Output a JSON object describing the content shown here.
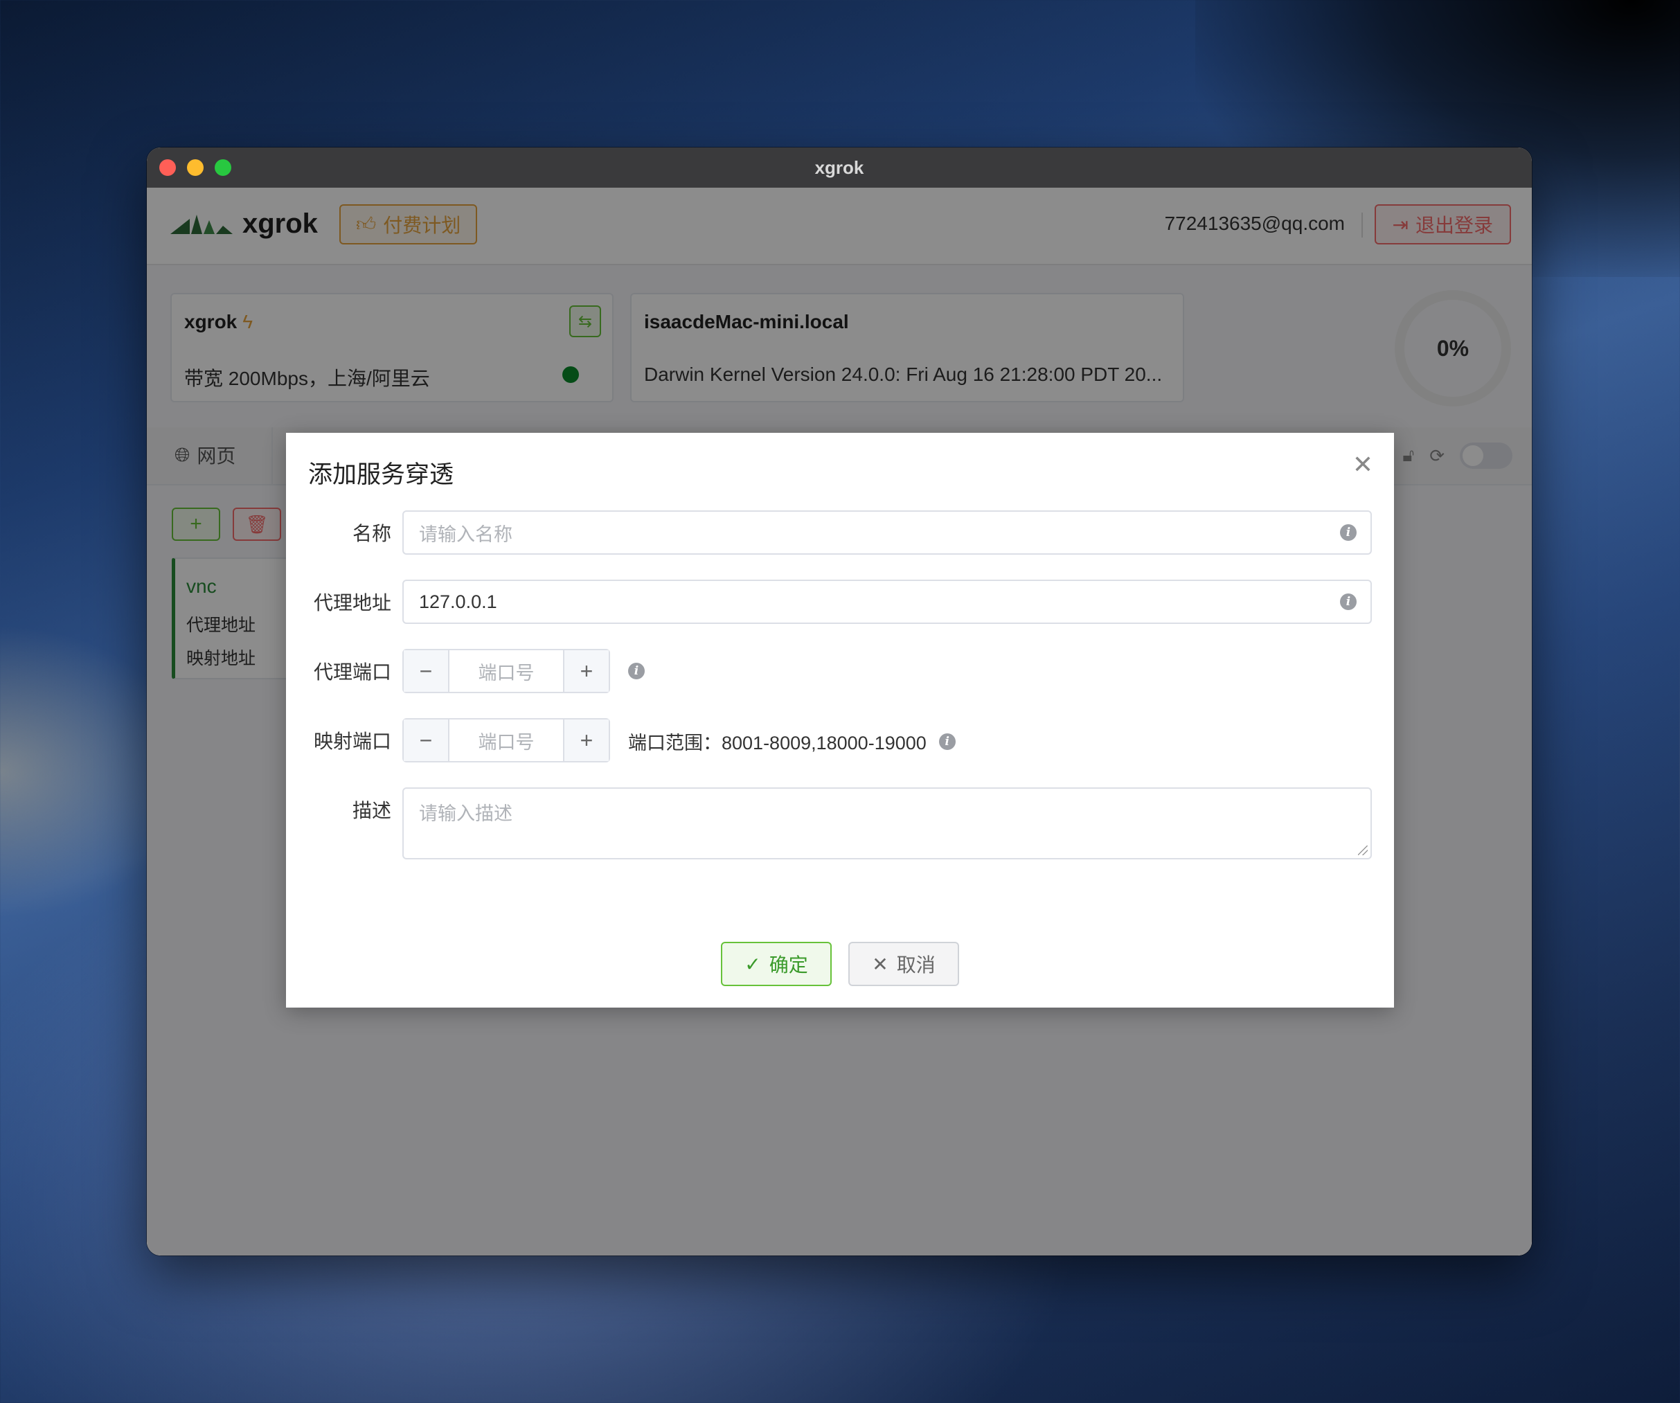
{
  "window": {
    "title": "xgrok"
  },
  "header": {
    "logo_text": "xgrok",
    "plan_label": "付费计划",
    "email": "772413635@qq.com",
    "logout_label": "退出登录"
  },
  "node_card": {
    "title": "xgrok",
    "subtitle": "带宽 200Mbps，上海/阿里云",
    "status_color": "#0a8a2a"
  },
  "host_card": {
    "title": "isaacdeMac-mini.local",
    "subtitle": "Darwin Kernel Version 24.0.0: Fri Aug 16 21:28:00 PDT 20..."
  },
  "usage": {
    "value": "0%"
  },
  "tabs": {
    "web_label": "网页"
  },
  "service": {
    "name": "vnc",
    "line1": "代理地址",
    "line2": "映射地址"
  },
  "dialog": {
    "title": "添加服务穿透",
    "fields": {
      "name": {
        "label": "名称",
        "placeholder": "请输入名称"
      },
      "proxy_addr": {
        "label": "代理地址",
        "value": "127.0.0.1"
      },
      "proxy_port": {
        "label": "代理端口",
        "placeholder": "端口号"
      },
      "map_port": {
        "label": "映射端口",
        "placeholder": "端口号",
        "range_text": "端口范围：8001-8009,18000-19000"
      },
      "desc": {
        "label": "描述",
        "placeholder": "请输入描述"
      }
    },
    "ok_label": "确定",
    "cancel_label": "取消"
  },
  "colors": {
    "accent": "#67c23a",
    "warning": "#e6a23c",
    "danger": "#f56c6c"
  }
}
